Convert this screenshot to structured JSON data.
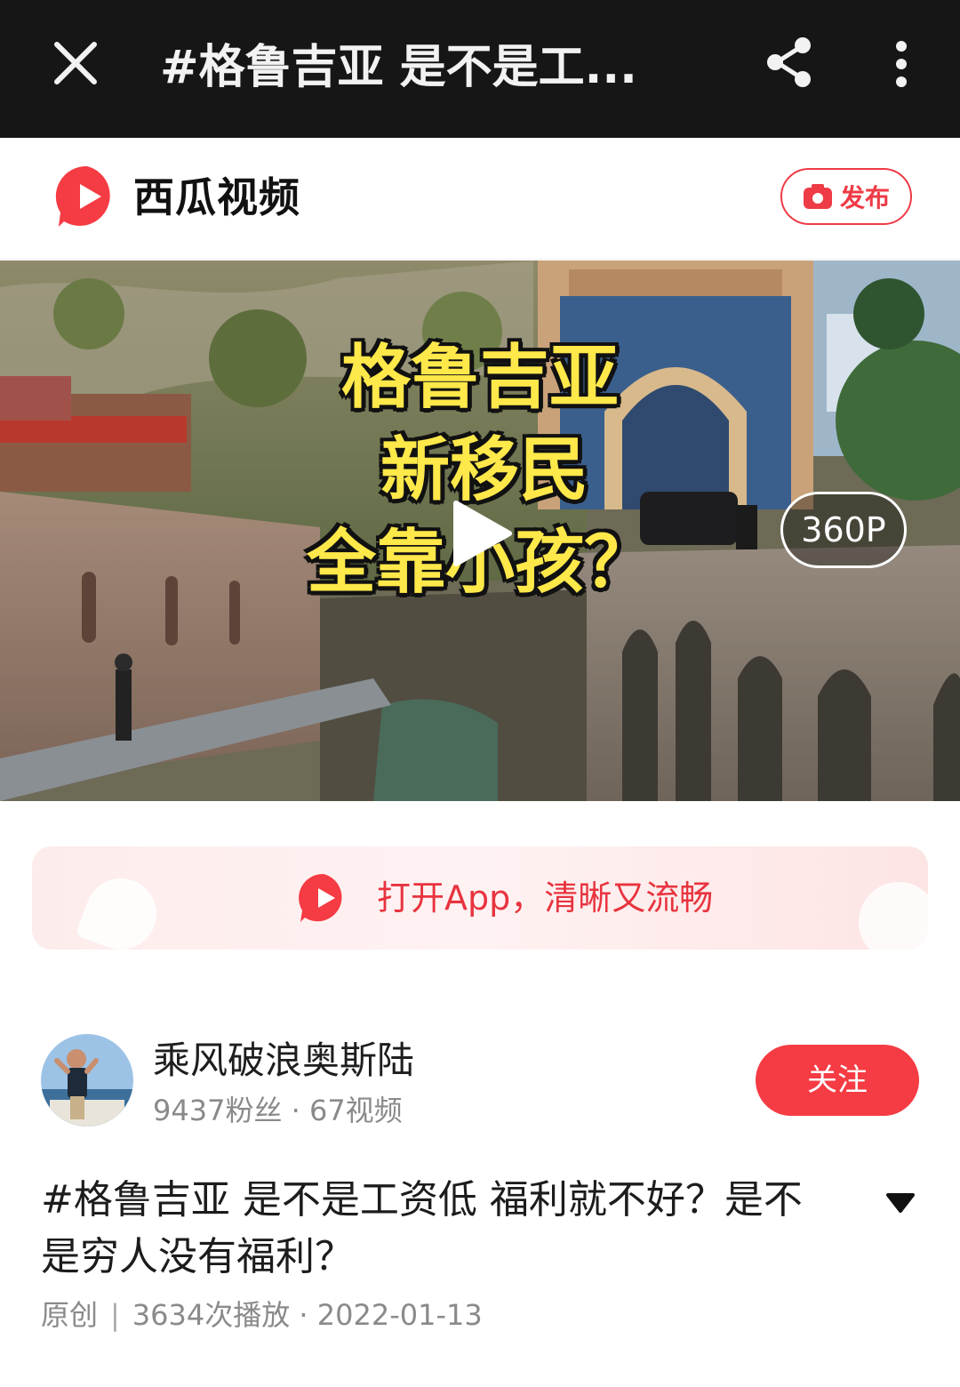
{
  "topbar": {
    "title": "#格鲁吉亚 是不是工...",
    "close_icon": "close-icon",
    "share_icon": "share-icon",
    "more_icon": "more-vertical-icon",
    "background": "#161616"
  },
  "brand": {
    "name": "西瓜视频",
    "logo_icon": "xigua-logo-icon",
    "publish_label": "发布",
    "accent": "#ee3b46"
  },
  "video": {
    "overlay_lines": [
      "格鲁吉亚",
      "新移民",
      "全靠小孩？"
    ],
    "quality": "360P",
    "play_icon": "play-icon"
  },
  "banner": {
    "text": "打开App，清晰又流畅"
  },
  "author": {
    "name": "乘风破浪奥斯陆",
    "stats": "9437粉丝 · 67视频",
    "follow_label": "关注"
  },
  "post": {
    "description": "#格鲁吉亚 是不是工资低 福利就不好？是不是穷人没有福利？",
    "expand_icon": "caret-down-icon",
    "original_label": "原创",
    "separator": "|",
    "plays_and_date": "3634次播放 · 2022-01-13"
  }
}
